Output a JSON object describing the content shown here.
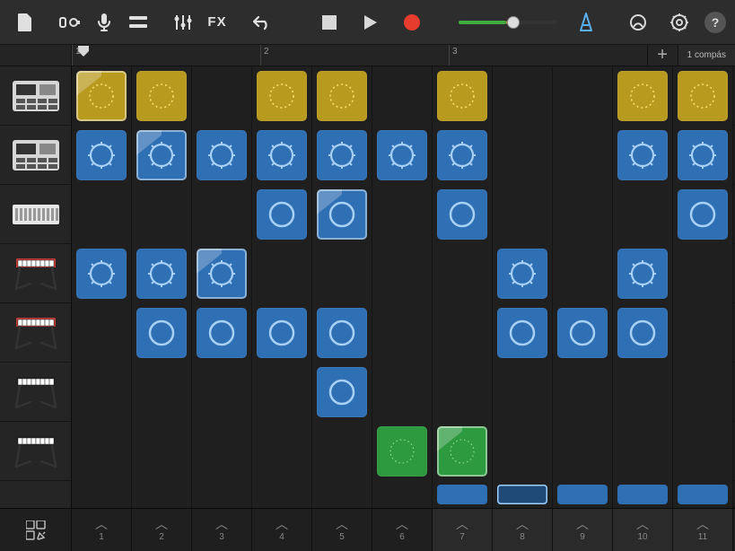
{
  "toolbar": {
    "metronome_on": true,
    "volume_percent": 55
  },
  "ruler": {
    "bars": [
      "1",
      "2",
      "3"
    ],
    "add_tooltip": "+",
    "compas_label": "1 compás"
  },
  "tracks": [
    {
      "name": "drum-machine-1",
      "kind": "drum-machine",
      "color": "#c4c4c4"
    },
    {
      "name": "drum-machine-2",
      "kind": "drum-machine",
      "color": "#c4c4c4"
    },
    {
      "name": "sampler",
      "kind": "sampler",
      "color": "#e8e8e8"
    },
    {
      "name": "keyboard-red-1",
      "kind": "keyboard",
      "color": "#c63a3a"
    },
    {
      "name": "keyboard-red-2",
      "kind": "keyboard",
      "color": "#c63a3a"
    },
    {
      "name": "keyboard-dark-1",
      "kind": "keyboard",
      "color": "#222"
    },
    {
      "name": "keyboard-dark-2",
      "kind": "keyboard",
      "color": "#222"
    }
  ],
  "grid": {
    "cols": 11,
    "rows": [
      {
        "color": "yellow",
        "viz": "dots",
        "cells": [
          1,
          1,
          0,
          1,
          1,
          0,
          1,
          0,
          0,
          1,
          1
        ]
      },
      {
        "color": "blue",
        "viz": "wavy",
        "cells": [
          1,
          1,
          1,
          1,
          1,
          1,
          1,
          0,
          0,
          1,
          1
        ]
      },
      {
        "color": "blue",
        "viz": "ring",
        "cells": [
          0,
          0,
          0,
          1,
          1,
          0,
          1,
          0,
          0,
          0,
          1
        ]
      },
      {
        "color": "blue",
        "viz": "wavy",
        "cells": [
          1,
          1,
          1,
          0,
          0,
          0,
          0,
          1,
          0,
          1,
          0
        ]
      },
      {
        "color": "blue",
        "viz": "ring",
        "cells": [
          0,
          1,
          1,
          1,
          1,
          0,
          0,
          1,
          1,
          1,
          0
        ]
      },
      {
        "color": "blue",
        "viz": "ring",
        "cells": [
          0,
          0,
          0,
          0,
          1,
          0,
          0,
          0,
          0,
          0,
          0
        ]
      },
      {
        "color": "green",
        "viz": "dots",
        "cells": [
          0,
          0,
          0,
          0,
          0,
          1,
          1,
          0,
          0,
          0,
          0
        ]
      }
    ],
    "playing": [
      {
        "row": 0,
        "col": 0
      },
      {
        "row": 1,
        "col": 1
      },
      {
        "row": 2,
        "col": 4
      },
      {
        "row": 3,
        "col": 2
      },
      {
        "row": 6,
        "col": 6
      }
    ],
    "clip_row": {
      "cells": [
        0,
        0,
        0,
        0,
        0,
        0,
        1,
        1,
        1,
        1,
        1
      ],
      "selected_col": 7
    }
  },
  "triggers": {
    "labels": [
      "1",
      "2",
      "3",
      "4",
      "5",
      "6",
      "7",
      "8",
      "9",
      "10",
      "11"
    ],
    "active": [
      6,
      7,
      8,
      9,
      10
    ]
  }
}
